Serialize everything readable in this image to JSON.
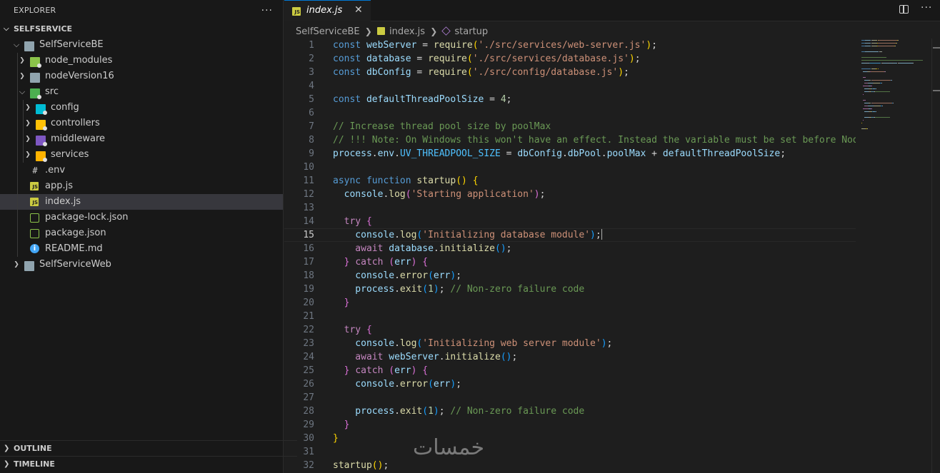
{
  "explorer": {
    "title": "EXPLORER",
    "more_label": "···",
    "workspace": "SELFSERVICE",
    "tree": [
      {
        "label": "SelfServiceBE",
        "kind": "folder-open",
        "color": "#90a4ae"
      },
      {
        "label": "node_modules",
        "kind": "folder",
        "color": "#8bc34a"
      },
      {
        "label": "nodeVersion16",
        "kind": "folder",
        "color": "#90a4ae"
      },
      {
        "label": "src",
        "kind": "folder-open",
        "color": "#4caf50"
      },
      {
        "label": "config",
        "kind": "folder",
        "color": "#00bcd4"
      },
      {
        "label": "controllers",
        "kind": "folder",
        "color": "#ffc107"
      },
      {
        "label": "middleware",
        "kind": "folder",
        "color": "#7e57c2"
      },
      {
        "label": "services",
        "kind": "folder",
        "color": "#ffb300"
      },
      {
        "label": ".env",
        "kind": "env-file"
      },
      {
        "label": "app.js",
        "kind": "js-file"
      },
      {
        "label": "index.js",
        "kind": "js-file"
      },
      {
        "label": "package-lock.json",
        "kind": "json-file"
      },
      {
        "label": "package.json",
        "kind": "json-file"
      },
      {
        "label": "README.md",
        "kind": "info-file"
      },
      {
        "label": "SelfServiceWeb",
        "kind": "folder",
        "color": "#90a4ae"
      }
    ],
    "outline": "OUTLINE",
    "timeline": "TIMELINE"
  },
  "tab": {
    "label": "index.js",
    "close": "✕",
    "icon_text": "JS"
  },
  "breadcrumb": {
    "folder": "SelfServiceBE",
    "file": "index.js",
    "symbol": "startup"
  },
  "editor": {
    "current_line": 15,
    "lines": [
      [
        [
          "const ",
          "#569cd6"
        ],
        [
          "webServer",
          "#9cdcfe"
        ],
        [
          " = ",
          "#d4d4d4"
        ],
        [
          "require",
          "#dcdcaa"
        ],
        [
          "(",
          "#ffd700"
        ],
        [
          "'./src/services/web-server.js'",
          "#ce9178"
        ],
        [
          ")",
          "#ffd700"
        ],
        [
          ";",
          "#d4d4d4"
        ]
      ],
      [
        [
          "const ",
          "#569cd6"
        ],
        [
          "database",
          "#9cdcfe"
        ],
        [
          " = ",
          "#d4d4d4"
        ],
        [
          "require",
          "#dcdcaa"
        ],
        [
          "(",
          "#ffd700"
        ],
        [
          "'./src/services/database.js'",
          "#ce9178"
        ],
        [
          ")",
          "#ffd700"
        ],
        [
          ";",
          "#d4d4d4"
        ]
      ],
      [
        [
          "const ",
          "#569cd6"
        ],
        [
          "dbConfig",
          "#9cdcfe"
        ],
        [
          " = ",
          "#d4d4d4"
        ],
        [
          "require",
          "#dcdcaa"
        ],
        [
          "(",
          "#ffd700"
        ],
        [
          "'./src/config/database.js'",
          "#ce9178"
        ],
        [
          ")",
          "#ffd700"
        ],
        [
          ";",
          "#d4d4d4"
        ]
      ],
      [],
      [
        [
          "const ",
          "#569cd6"
        ],
        [
          "defaultThreadPoolSize",
          "#9cdcfe"
        ],
        [
          " = ",
          "#d4d4d4"
        ],
        [
          "4",
          "#b5cea8"
        ],
        [
          ";",
          "#d4d4d4"
        ]
      ],
      [],
      [
        [
          "// Increase thread pool size by poolMax",
          "#6a9955"
        ]
      ],
      [
        [
          "// !!! Note: On Windows this won't have an effect. Instead the variable must be set before Node",
          "#6a9955"
        ]
      ],
      [
        [
          "process",
          "#9cdcfe"
        ],
        [
          ".",
          "#d4d4d4"
        ],
        [
          "env",
          "#9cdcfe"
        ],
        [
          ".",
          "#d4d4d4"
        ],
        [
          "UV_THREADPOOL_SIZE",
          "#4fc1ff"
        ],
        [
          " = ",
          "#d4d4d4"
        ],
        [
          "dbConfig",
          "#9cdcfe"
        ],
        [
          ".",
          "#d4d4d4"
        ],
        [
          "dbPool",
          "#9cdcfe"
        ],
        [
          ".",
          "#d4d4d4"
        ],
        [
          "poolMax",
          "#9cdcfe"
        ],
        [
          " + ",
          "#d4d4d4"
        ],
        [
          "defaultThreadPoolSize",
          "#9cdcfe"
        ],
        [
          ";",
          "#d4d4d4"
        ]
      ],
      [],
      [
        [
          "async ",
          "#569cd6"
        ],
        [
          "function ",
          "#569cd6"
        ],
        [
          "startup",
          "#dcdcaa"
        ],
        [
          "()",
          "#ffd700"
        ],
        [
          " {",
          "#ffd700"
        ]
      ],
      [
        [
          "  console",
          "#9cdcfe"
        ],
        [
          ".",
          "#d4d4d4"
        ],
        [
          "log",
          "#dcdcaa"
        ],
        [
          "(",
          "#da70d6"
        ],
        [
          "'Starting application'",
          "#ce9178"
        ],
        [
          ")",
          "#da70d6"
        ],
        [
          ";",
          "#d4d4d4"
        ]
      ],
      [],
      [
        [
          "  try ",
          "#c586c0"
        ],
        [
          "{",
          "#da70d6"
        ]
      ],
      [
        [
          "    console",
          "#9cdcfe"
        ],
        [
          ".",
          "#d4d4d4"
        ],
        [
          "log",
          "#dcdcaa"
        ],
        [
          "(",
          "#179fff"
        ],
        [
          "'Initializing database module'",
          "#ce9178"
        ],
        [
          ")",
          "#179fff"
        ],
        [
          ";",
          "#d4d4d4"
        ]
      ],
      [
        [
          "    await ",
          "#c586c0"
        ],
        [
          "database",
          "#9cdcfe"
        ],
        [
          ".",
          "#d4d4d4"
        ],
        [
          "initialize",
          "#dcdcaa"
        ],
        [
          "()",
          "#179fff"
        ],
        [
          ";",
          "#d4d4d4"
        ]
      ],
      [
        [
          "  } ",
          "#da70d6"
        ],
        [
          "catch ",
          "#c586c0"
        ],
        [
          "(",
          "#da70d6"
        ],
        [
          "err",
          "#9cdcfe"
        ],
        [
          ")",
          "#da70d6"
        ],
        [
          " {",
          "#da70d6"
        ]
      ],
      [
        [
          "    console",
          "#9cdcfe"
        ],
        [
          ".",
          "#d4d4d4"
        ],
        [
          "error",
          "#dcdcaa"
        ],
        [
          "(",
          "#179fff"
        ],
        [
          "err",
          "#9cdcfe"
        ],
        [
          ")",
          "#179fff"
        ],
        [
          ";",
          "#d4d4d4"
        ]
      ],
      [
        [
          "    process",
          "#9cdcfe"
        ],
        [
          ".",
          "#d4d4d4"
        ],
        [
          "exit",
          "#dcdcaa"
        ],
        [
          "(",
          "#179fff"
        ],
        [
          "1",
          "#b5cea8"
        ],
        [
          ")",
          "#179fff"
        ],
        [
          "; ",
          "#d4d4d4"
        ],
        [
          "// Non-zero failure code",
          "#6a9955"
        ]
      ],
      [
        [
          "  }",
          "#da70d6"
        ]
      ],
      [],
      [
        [
          "  try ",
          "#c586c0"
        ],
        [
          "{",
          "#da70d6"
        ]
      ],
      [
        [
          "    console",
          "#9cdcfe"
        ],
        [
          ".",
          "#d4d4d4"
        ],
        [
          "log",
          "#dcdcaa"
        ],
        [
          "(",
          "#179fff"
        ],
        [
          "'Initializing web server module'",
          "#ce9178"
        ],
        [
          ")",
          "#179fff"
        ],
        [
          ";",
          "#d4d4d4"
        ]
      ],
      [
        [
          "    await ",
          "#c586c0"
        ],
        [
          "webServer",
          "#9cdcfe"
        ],
        [
          ".",
          "#d4d4d4"
        ],
        [
          "initialize",
          "#dcdcaa"
        ],
        [
          "()",
          "#179fff"
        ],
        [
          ";",
          "#d4d4d4"
        ]
      ],
      [
        [
          "  } ",
          "#da70d6"
        ],
        [
          "catch ",
          "#c586c0"
        ],
        [
          "(",
          "#da70d6"
        ],
        [
          "err",
          "#9cdcfe"
        ],
        [
          ")",
          "#da70d6"
        ],
        [
          " {",
          "#da70d6"
        ]
      ],
      [
        [
          "    console",
          "#9cdcfe"
        ],
        [
          ".",
          "#d4d4d4"
        ],
        [
          "error",
          "#dcdcaa"
        ],
        [
          "(",
          "#179fff"
        ],
        [
          "err",
          "#9cdcfe"
        ],
        [
          ")",
          "#179fff"
        ],
        [
          ";",
          "#d4d4d4"
        ]
      ],
      [],
      [
        [
          "    process",
          "#9cdcfe"
        ],
        [
          ".",
          "#d4d4d4"
        ],
        [
          "exit",
          "#dcdcaa"
        ],
        [
          "(",
          "#179fff"
        ],
        [
          "1",
          "#b5cea8"
        ],
        [
          ")",
          "#179fff"
        ],
        [
          "; ",
          "#d4d4d4"
        ],
        [
          "// Non-zero failure code",
          "#6a9955"
        ]
      ],
      [
        [
          "  }",
          "#da70d6"
        ]
      ],
      [
        [
          "}",
          "#ffd700"
        ]
      ],
      [],
      [
        [
          "startup",
          "#dcdcaa"
        ],
        [
          "()",
          "#ffd700"
        ],
        [
          ";",
          "#d4d4d4"
        ]
      ]
    ]
  },
  "watermark": "خمسات"
}
